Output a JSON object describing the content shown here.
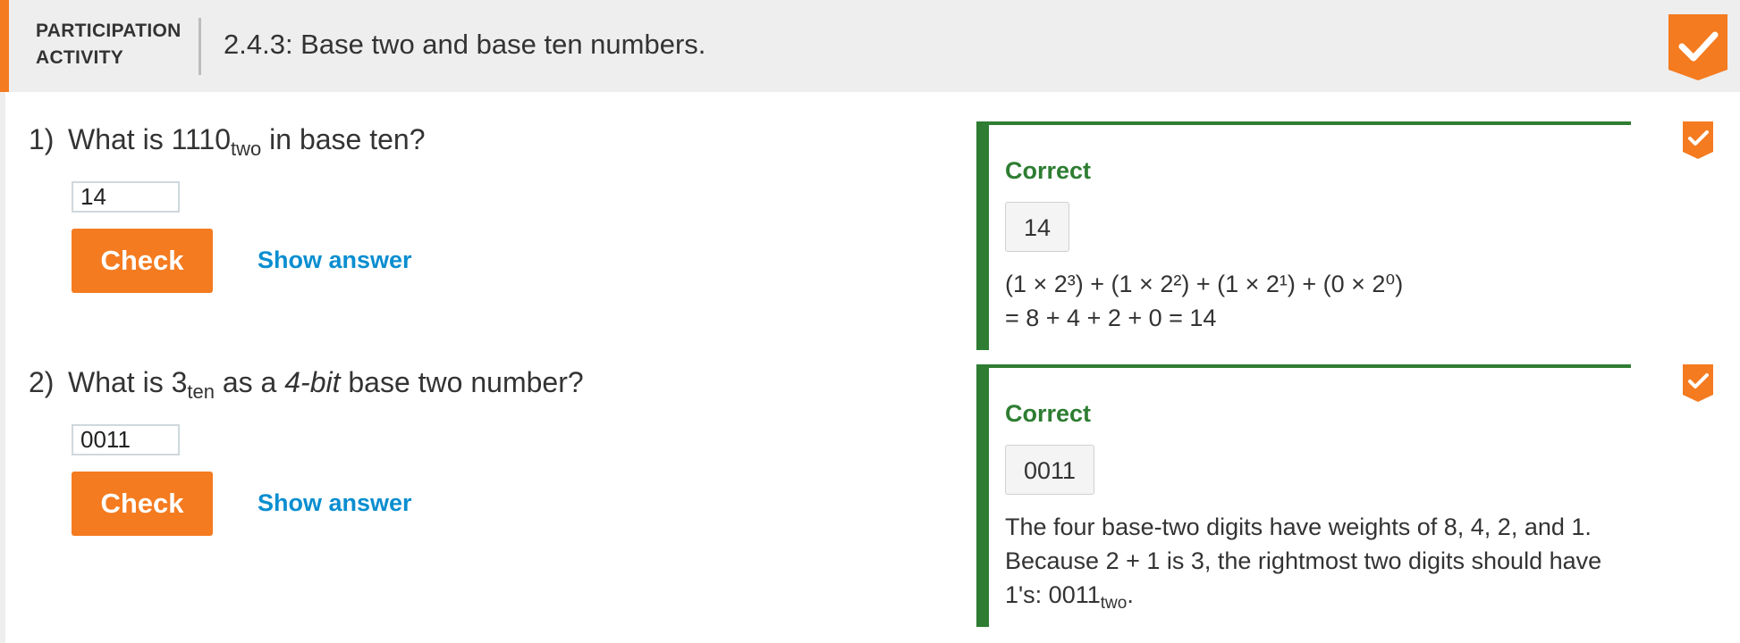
{
  "header": {
    "label_line1": "PARTICIPATION",
    "label_line2": "ACTIVITY",
    "title": "2.4.3: Base two and base ten numbers."
  },
  "colors": {
    "accent": "#f47b20",
    "correct": "#2e7d32",
    "link": "#0a8ed0"
  },
  "questions": [
    {
      "number": "1)",
      "text_before": "What is 1110",
      "text_sub": "two",
      "text_italic": "",
      "text_after": " in base ten?",
      "input_value": "14",
      "check_label": "Check",
      "show_answer_label": "Show answer",
      "feedback": {
        "status": "Correct",
        "answer": "14",
        "expl_line1": "(1 × 2³) + (1 × 2²) + (1 × 2¹) + (0 × 2⁰)",
        "expl_line2": "= 8 + 4 + 2 + 0 = 14"
      }
    },
    {
      "number": "2)",
      "text_before": "What is 3",
      "text_sub": "ten",
      "text_mid": " as a ",
      "text_italic": "4-bit",
      "text_after": " base two number?",
      "input_value": "0011",
      "check_label": "Check",
      "show_answer_label": "Show answer",
      "feedback": {
        "status": "Correct",
        "answer": "0011",
        "expl_line1": "The four base-two digits have weights of 8, 4, 2, and 1.",
        "expl_line2": "Because 2 + 1 is 3, the rightmost two digits should have",
        "expl_line3_before": "1's: 0011",
        "expl_line3_sub": "two",
        "expl_line3_after": "."
      }
    }
  ]
}
